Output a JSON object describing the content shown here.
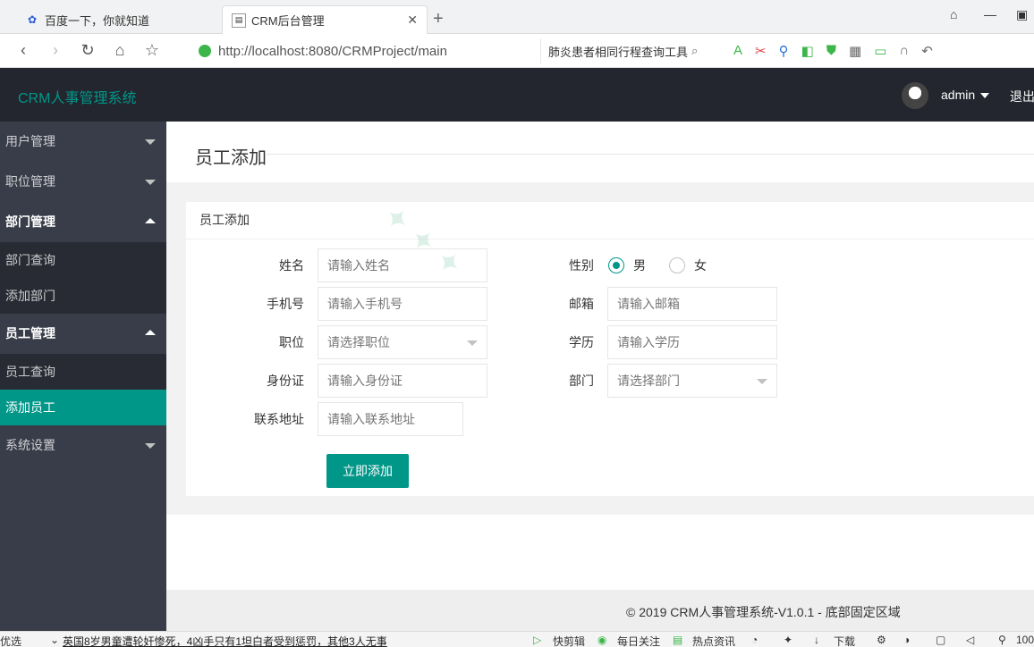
{
  "browser": {
    "tabs": [
      {
        "label": "百度一下，你就知道",
        "active": false,
        "icon": "baidu-paw-icon"
      },
      {
        "label": "CRM后台管理",
        "active": true,
        "icon": "page-favicon"
      }
    ],
    "new_tab": "+",
    "url": "http://localhost:8080/CRMProject/main",
    "search_text": "肺炎患者相同行程查询工具"
  },
  "header": {
    "logo": "CRM人事管理系统",
    "username": "admin",
    "logout": "退出"
  },
  "sidebar": {
    "items": [
      {
        "label": "用户管理",
        "expanded": false
      },
      {
        "label": "职位管理",
        "expanded": false
      },
      {
        "label": "部门管理",
        "expanded": true,
        "children": [
          "部门查询",
          "添加部门"
        ]
      },
      {
        "label": "员工管理",
        "expanded": true,
        "children": [
          "员工查询",
          "添加员工"
        ],
        "active_child": "添加员工"
      },
      {
        "label": "系统设置",
        "expanded": false
      }
    ]
  },
  "main": {
    "page_title": "员工添加",
    "card_title": "员工添加",
    "form": {
      "name_label": "姓名",
      "name_placeholder": "请输入姓名",
      "gender_label": "性别",
      "gender_male": "男",
      "gender_female": "女",
      "gender_selected": "男",
      "phone_label": "手机号",
      "phone_placeholder": "请输入手机号",
      "email_label": "邮箱",
      "email_placeholder": "请输入邮箱",
      "position_label": "职位",
      "position_placeholder": "请选择职位",
      "education_label": "学历",
      "education_placeholder": "请输入学历",
      "idcard_label": "身份证",
      "idcard_placeholder": "请输入身份证",
      "dept_label": "部门",
      "dept_placeholder": "请选择部门",
      "address_label": "联系地址",
      "address_placeholder": "请输入联系地址",
      "submit": "立即添加"
    },
    "footer": "© 2019 CRM人事管理系统-V1.0.1 - 底部固定区域"
  },
  "statusbar": {
    "left": "优选",
    "headline": "英国8岁男童遭轮奸惨死，4凶手只有1坦白者受到惩罚，其他3人无事",
    "items": [
      "快剪辑",
      "每日关注",
      "热点资讯",
      "下载",
      "100"
    ]
  },
  "colors": {
    "accent": "#009688",
    "header_bg": "#23262e",
    "sidebar_bg": "#393d49",
    "sidebar_child_bg": "#282b33"
  }
}
